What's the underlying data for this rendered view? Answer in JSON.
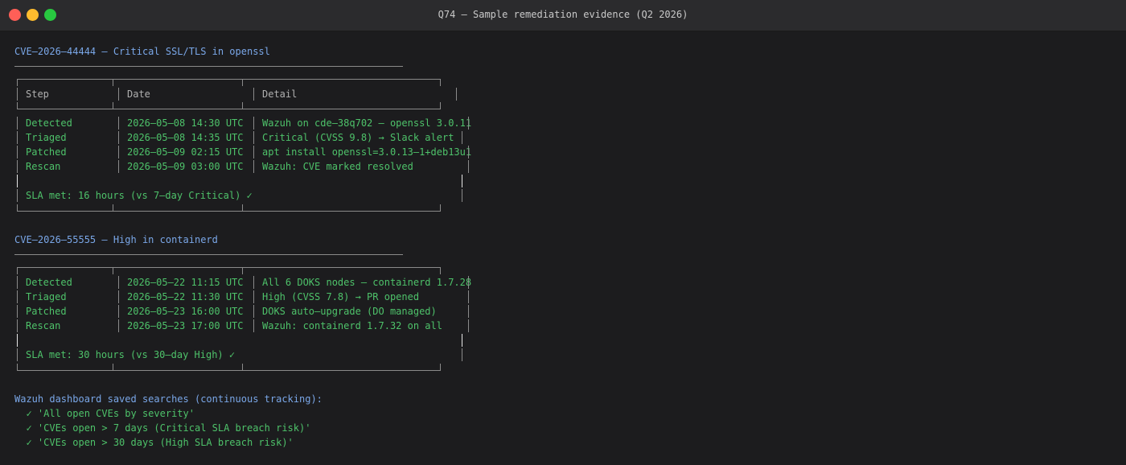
{
  "window": {
    "title": "Q74 — Sample remediation evidence (Q2 2026)"
  },
  "cve1": {
    "heading": "CVE–2026–44444 — Critical SSL/TLS in openssl",
    "headers": {
      "step": "Step",
      "date": "Date",
      "detail": "Detail"
    },
    "rows": [
      {
        "step": "Detected",
        "date": "2026–05–08 14:30 UTC",
        "detail": "Wazuh on cde–38q702 — openssl 3.0.11"
      },
      {
        "step": "Triaged",
        "date": "2026–05–08 14:35 UTC",
        "detail": "Critical (CVSS 9.8) → Slack alert"
      },
      {
        "step": "Patched",
        "date": "2026–05–09 02:15 UTC",
        "detail": "apt install openssl=3.0.13–1+deb13u1"
      },
      {
        "step": "Rescan",
        "date": "2026–05–09 03:00 UTC",
        "detail": "Wazuh: CVE marked resolved"
      }
    ],
    "sla": "SLA met: 16 hours (vs 7–day Critical) ✓"
  },
  "cve2": {
    "heading": "CVE–2026–55555 — High in containerd",
    "rows": [
      {
        "step": "Detected",
        "date": "2026–05–22 11:15 UTC",
        "detail": "All 6 DOKS nodes — containerd 1.7.28"
      },
      {
        "step": "Triaged",
        "date": "2026–05–22 11:30 UTC",
        "detail": "High (CVSS 7.8) → PR opened"
      },
      {
        "step": "Patched",
        "date": "2026–05–23 16:00 UTC",
        "detail": "DOKS auto–upgrade (DO managed)"
      },
      {
        "step": "Rescan",
        "date": "2026–05–23 17:00 UTC",
        "detail": "Wazuh: containerd 1.7.32 on all"
      }
    ],
    "sla": "SLA met: 30 hours (vs 30–day High) ✓"
  },
  "saved_searches": {
    "heading": "Wazuh dashboard saved searches (continuous tracking):",
    "items": [
      "  ✓ 'All open CVEs by severity'",
      "  ✓ 'CVEs open > 7 days (Critical SLA breach risk)'",
      "  ✓ 'CVEs open > 30 days (High SLA breach risk)'"
    ]
  },
  "colors": {
    "background": "#1c1c1e",
    "heading_blue": "#7aa7e8",
    "row_green": "#4ec26a",
    "border_gray": "#8a8a8a"
  }
}
